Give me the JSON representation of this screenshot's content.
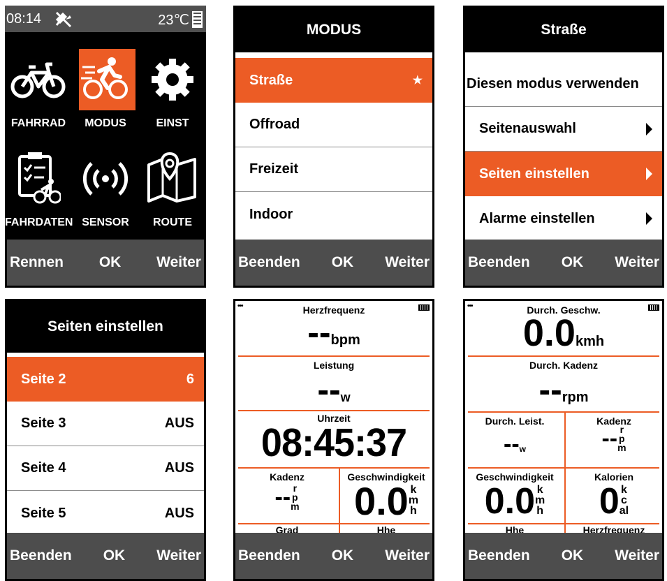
{
  "main_menu": {
    "status": {
      "time": "08:14",
      "temperature": "23℃"
    },
    "items": [
      {
        "label": "FAHRRAD",
        "icon": "bicycle-icon"
      },
      {
        "label": "MODUS",
        "icon": "cyclist-icon"
      },
      {
        "label": "EINST",
        "icon": "gear-icon"
      },
      {
        "label": "FAHRDATEN",
        "icon": "clipboard-cyclist-icon"
      },
      {
        "label": "SENSOR",
        "icon": "sensor-signal-icon"
      },
      {
        "label": "ROUTE",
        "icon": "map-pin-icon"
      }
    ],
    "footer": {
      "left": "Rennen",
      "center": "OK",
      "right": "Weiter"
    }
  },
  "modus_menu": {
    "title": "MODUS",
    "items": [
      {
        "label": "Straße",
        "marker": "★"
      },
      {
        "label": "Offroad"
      },
      {
        "label": "Freizeit"
      },
      {
        "label": "Indoor"
      }
    ],
    "footer": {
      "left": "Beenden",
      "center": "OK",
      "right": "Weiter"
    }
  },
  "strasse_menu": {
    "title": "Straße",
    "items": [
      {
        "label": "Diesen modus verwenden"
      },
      {
        "label": "Seitenauswahl"
      },
      {
        "label": "Seiten einstellen"
      },
      {
        "label": "Alarme einstellen"
      }
    ],
    "footer": {
      "left": "Beenden",
      "center": "OK",
      "right": "Weiter"
    }
  },
  "seiten_menu": {
    "title": "Seiten einstellen",
    "items": [
      {
        "label": "Seite 2",
        "value": "6"
      },
      {
        "label": "Seite 3",
        "value": "AUS"
      },
      {
        "label": "Seite 4",
        "value": "AUS"
      },
      {
        "label": "Seite 5",
        "value": "AUS"
      }
    ],
    "footer": {
      "left": "Beenden",
      "center": "OK",
      "right": "Weiter"
    }
  },
  "data_page_1": {
    "indicator": "•••",
    "fields": {
      "herzfrequenz": {
        "label": "Herzfrequenz",
        "value": "--",
        "unit": "bpm"
      },
      "leistung": {
        "label": "Leistung",
        "value": "--",
        "unit": "w"
      },
      "uhrzeit": {
        "label": "Uhrzeit",
        "value": "08:45:37"
      },
      "kadenz": {
        "label": "Kadenz",
        "value": "--",
        "unit": [
          "r",
          "p",
          "m"
        ]
      },
      "geschwindigkeit": {
        "label": "Geschwindigkeit",
        "value": "0.0",
        "unit": [
          "k",
          "m",
          "h"
        ]
      },
      "grad": {
        "label": "Grad"
      },
      "hhe": {
        "label": "Hhe"
      }
    },
    "footer": {
      "left": "Beenden",
      "center": "OK",
      "right": "Weiter"
    }
  },
  "data_page_2": {
    "indicator": "•••",
    "fields": {
      "durch_geschw": {
        "label": "Durch. Geschw.",
        "value": "0.0",
        "unit": "kmh"
      },
      "durch_kadenz": {
        "label": "Durch. Kadenz",
        "value": "--",
        "unit": "rpm"
      },
      "durch_leist": {
        "label": "Durch. Leist.",
        "value": "--",
        "unit": "w"
      },
      "kadenz": {
        "label": "Kadenz",
        "value": "--",
        "unit": [
          "r",
          "p",
          "m"
        ]
      },
      "geschwindigkeit": {
        "label": "Geschwindigkeit",
        "value": "0.0",
        "unit": [
          "k",
          "m",
          "h"
        ]
      },
      "kalorien": {
        "label": "Kalorien",
        "value": "0",
        "unit": [
          "k",
          "c",
          "al"
        ]
      },
      "hhe": {
        "label": "Hhe"
      },
      "herzfrequenz": {
        "label": "Herzfrequenz"
      }
    },
    "footer": {
      "left": "Beenden",
      "center": "OK",
      "right": "Weiter"
    }
  },
  "colors": {
    "accent": "#ec5c25",
    "footer": "#4d4d4d",
    "status": "#505050"
  }
}
